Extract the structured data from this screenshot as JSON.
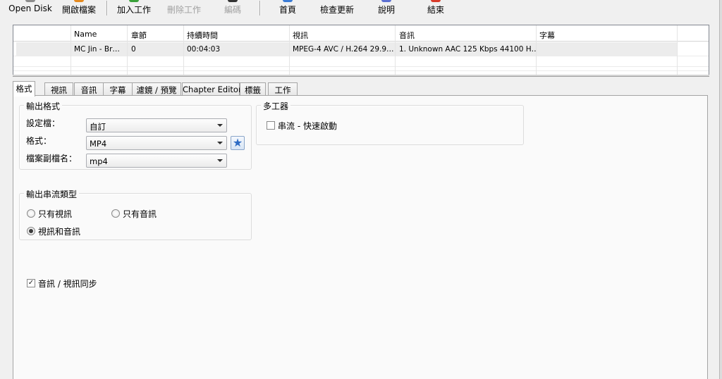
{
  "toolbar": {
    "open_disk": "Open Disk",
    "open_file": "開啟檔案",
    "add_job": "加入工作",
    "remove_job": "刪除工作",
    "encode": "編碼",
    "home": "首頁",
    "check_update": "檢查更新",
    "help": "說明",
    "exit": "結束"
  },
  "source_grid": {
    "headers": [
      "Name",
      "章節",
      "持續時間",
      "視訊",
      "音訊",
      "字幕"
    ],
    "row": {
      "name": "MC Jin - Br…",
      "chapters": "0",
      "duration": "00:04:03",
      "video": "MPEG-4 AVC / H.264 29.9…",
      "audio": "1. Unknown AAC  125 Kbps 44100 H…",
      "subtitle": ""
    }
  },
  "tabs": [
    "格式",
    "視訊",
    "音訊",
    "字幕",
    "濾鏡 / 預覽",
    "Chapter Editor",
    "標籤",
    "工作"
  ],
  "output_format": {
    "title": "輸出格式",
    "profile_label": "設定檔：",
    "profile_value": "自訂",
    "format_label": "格式：",
    "format_value": "MP4",
    "extension_label": "檔案副檔名：",
    "extension_value": "mp4"
  },
  "multiplexer": {
    "title": "多工器",
    "streaming_label": "串流 - 快速啟動",
    "streaming_checked": false
  },
  "stream_type": {
    "title": "輸出串流類型",
    "video_only": "只有視訊",
    "audio_only": "只有音訊",
    "video_and_audio": "視訊和音訊",
    "selected": "video_and_audio"
  },
  "av_sync": {
    "label": "音訊 / 視訊同步",
    "checked": true
  },
  "colors": {
    "open_file_icon": "#e58a1f",
    "add_job_icon": "#3aa13a",
    "encode_icon": "#333333",
    "home_icon": "#3a7bd5",
    "help_icon": "#5b6fd1",
    "exit_icon": "#d83b2a"
  }
}
